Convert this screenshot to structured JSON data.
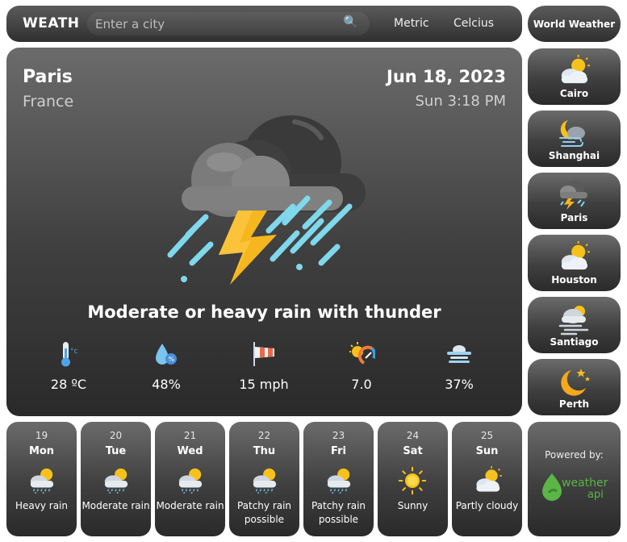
{
  "header": {
    "brand": "WEATH",
    "search_placeholder": "Enter a city",
    "units_metric": "Metric",
    "units_celcius": "Celcius",
    "world_weather": "World Weather"
  },
  "current": {
    "city": "Paris",
    "country": "France",
    "date": "Jun 18, 2023",
    "time": "Sun 3:18 PM",
    "condition": "Moderate or heavy rain with thunder",
    "stats": [
      {
        "icon": "thermometer-icon",
        "value": "28 ºC"
      },
      {
        "icon": "humidity-icon",
        "value": "48%"
      },
      {
        "icon": "wind-icon",
        "value": "15 mph"
      },
      {
        "icon": "uv-index-icon",
        "value": "7.0"
      },
      {
        "icon": "cloud-cover-icon",
        "value": "37%"
      }
    ]
  },
  "cities": [
    {
      "name": "Cairo",
      "icon": "partly-cloudy-icon"
    },
    {
      "name": "Shanghai",
      "icon": "night-windy-cloud-icon"
    },
    {
      "name": "Paris",
      "icon": "thunderstorm-icon"
    },
    {
      "name": "Houston",
      "icon": "partly-cloudy-icon"
    },
    {
      "name": "Santiago",
      "icon": "fog-icon"
    },
    {
      "name": "Perth",
      "icon": "moon-stars-icon"
    }
  ],
  "forecast": [
    {
      "num": "19",
      "day": "Mon",
      "desc": "Heavy rain",
      "icon": "sun-cloud-rain-icon"
    },
    {
      "num": "20",
      "day": "Tue",
      "desc": "Moderate rain",
      "icon": "sun-cloud-rain-icon"
    },
    {
      "num": "21",
      "day": "Wed",
      "desc": "Moderate rain",
      "icon": "sun-cloud-rain-icon"
    },
    {
      "num": "22",
      "day": "Thu",
      "desc": "Patchy rain possible",
      "icon": "sun-cloud-rain-icon"
    },
    {
      "num": "23",
      "day": "Fri",
      "desc": "Patchy rain possible",
      "icon": "sun-cloud-rain-icon"
    },
    {
      "num": "24",
      "day": "Sat",
      "desc": "Sunny",
      "icon": "sun-icon"
    },
    {
      "num": "25",
      "day": "Sun",
      "desc": "Partly cloudy",
      "icon": "partly-cloudy-icon"
    }
  ],
  "powered": {
    "label": "Powered by:",
    "logo_text_1": "weather",
    "logo_text_2": "api"
  },
  "colors": {
    "panel_top": "#6b6b6b",
    "panel_bottom": "#2a2a2a",
    "bolt": "#f6b61e",
    "rain": "#7fd8ec",
    "sun": "#f7c11b",
    "logo_green": "#5bb547"
  }
}
